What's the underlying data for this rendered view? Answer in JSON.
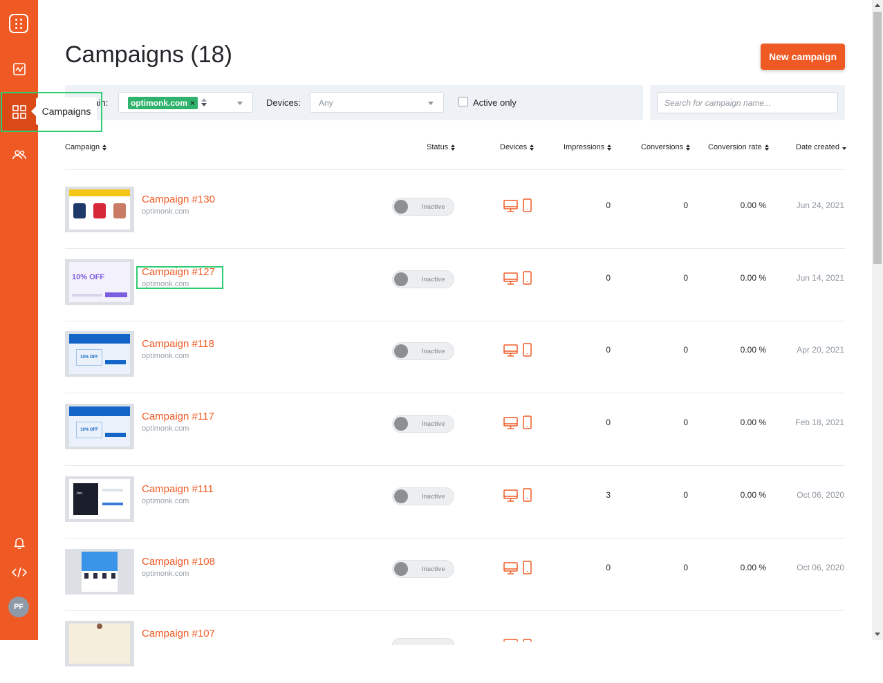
{
  "sidebar": {
    "tooltip": "Campaigns",
    "avatar_initials": "PF",
    "icons": [
      "app-logo-icon",
      "analytics-icon",
      "campaigns-grid-icon",
      "subscribers-icon",
      "bell-icon",
      "code-icon"
    ]
  },
  "header": {
    "title": "Campaigns (18)",
    "new_campaign_label": "New campaign"
  },
  "filters": {
    "domain_label": "Domain:",
    "domain_chip": "optimonk.com",
    "devices_label": "Devices:",
    "devices_value": "Any",
    "active_only_label": "Active only",
    "search_placeholder": "Search for campaign name..."
  },
  "table": {
    "columns": [
      "Campaign",
      "Status",
      "Devices",
      "Impressions",
      "Conversions",
      "Conversion rate",
      "Date created"
    ],
    "rows": [
      {
        "name": "Campaign #130",
        "domain": "optimonk.com",
        "status": "Inactive",
        "impressions": "0",
        "conversions": "0",
        "rate": "0.00 %",
        "date": "Jun 24, 2021"
      },
      {
        "name": "Campaign #127",
        "domain": "optimonk.com",
        "status": "Inactive",
        "impressions": "0",
        "conversions": "0",
        "rate": "0.00 %",
        "date": "Jun 14, 2021"
      },
      {
        "name": "Campaign #118",
        "domain": "optimonk.com",
        "status": "Inactive",
        "impressions": "0",
        "conversions": "0",
        "rate": "0.00 %",
        "date": "Apr 20, 2021"
      },
      {
        "name": "Campaign #117",
        "domain": "optimonk.com",
        "status": "Inactive",
        "impressions": "0",
        "conversions": "0",
        "rate": "0.00 %",
        "date": "Feb 18, 2021"
      },
      {
        "name": "Campaign #111",
        "domain": "optimonk.com",
        "status": "Inactive",
        "impressions": "3",
        "conversions": "0",
        "rate": "0.00 %",
        "date": "Oct 06, 2020"
      },
      {
        "name": "Campaign #108",
        "domain": "optimonk.com",
        "status": "Inactive",
        "impressions": "0",
        "conversions": "0",
        "rate": "0.00 %",
        "date": "Oct 06, 2020"
      },
      {
        "name": "Campaign #107",
        "domain": "",
        "status": "",
        "impressions": "",
        "conversions": "",
        "rate": "",
        "date": ""
      }
    ]
  },
  "colors": {
    "accent": "#ef5a24",
    "chip": "#2fb26b",
    "highlight": "#2ecc71"
  }
}
